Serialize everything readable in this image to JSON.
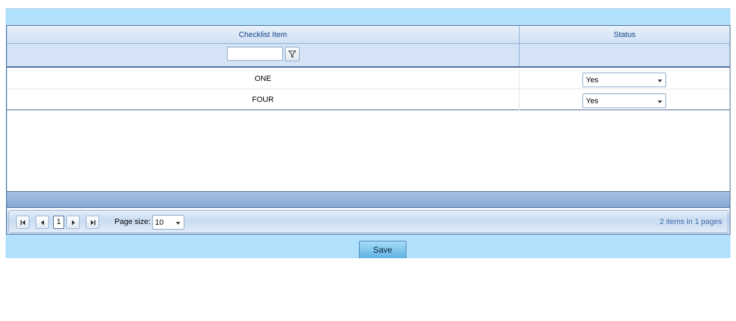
{
  "grid": {
    "columns": [
      "Checklist Item",
      "Status"
    ],
    "filter": {
      "value": "",
      "icon": "filter-icon"
    },
    "rows": [
      {
        "item": "ONE",
        "status": "Yes"
      },
      {
        "item": "FOUR",
        "status": "Yes"
      }
    ]
  },
  "pager": {
    "current_page": "1",
    "page_size_label": "Page size:",
    "page_size": "10",
    "info": "2 items in 1 pages"
  },
  "actions": {
    "save_label": "Save"
  },
  "colors": {
    "panel_bg": "#b2e1fd",
    "header_text": "#15428b",
    "border": "#4d6b95",
    "save_button": "#5fb1e3"
  }
}
